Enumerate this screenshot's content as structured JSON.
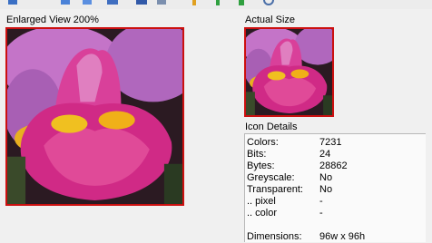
{
  "toolbar": {
    "icons": [
      "edit-icon",
      "copy-icon",
      "library-icon",
      "number-icon",
      "table-icon",
      "arrow-up-icon",
      "arrow-down-icon",
      "arrow-right-icon",
      "refresh-icon"
    ]
  },
  "enlarged": {
    "label": "Enlarged View 200%"
  },
  "actual": {
    "label": "Actual Size"
  },
  "details": {
    "title": "Icon Details",
    "rows": [
      {
        "label": "Colors:",
        "value": "7231"
      },
      {
        "label": "Bits:",
        "value": "24"
      },
      {
        "label": "Bytes:",
        "value": "28862"
      },
      {
        "label": "Greyscale:",
        "value": "No"
      },
      {
        "label": "Transparent:",
        "value": "No"
      },
      {
        "label": ".. pixel",
        "value": "-"
      },
      {
        "label": ".. color",
        "value": "-"
      },
      {
        "label": "",
        "value": ""
      },
      {
        "label": "Dimensions:",
        "value": "96w x 96h"
      }
    ]
  },
  "colors": {
    "frame_border": "#cc1010",
    "background": "#f0f0f0"
  }
}
